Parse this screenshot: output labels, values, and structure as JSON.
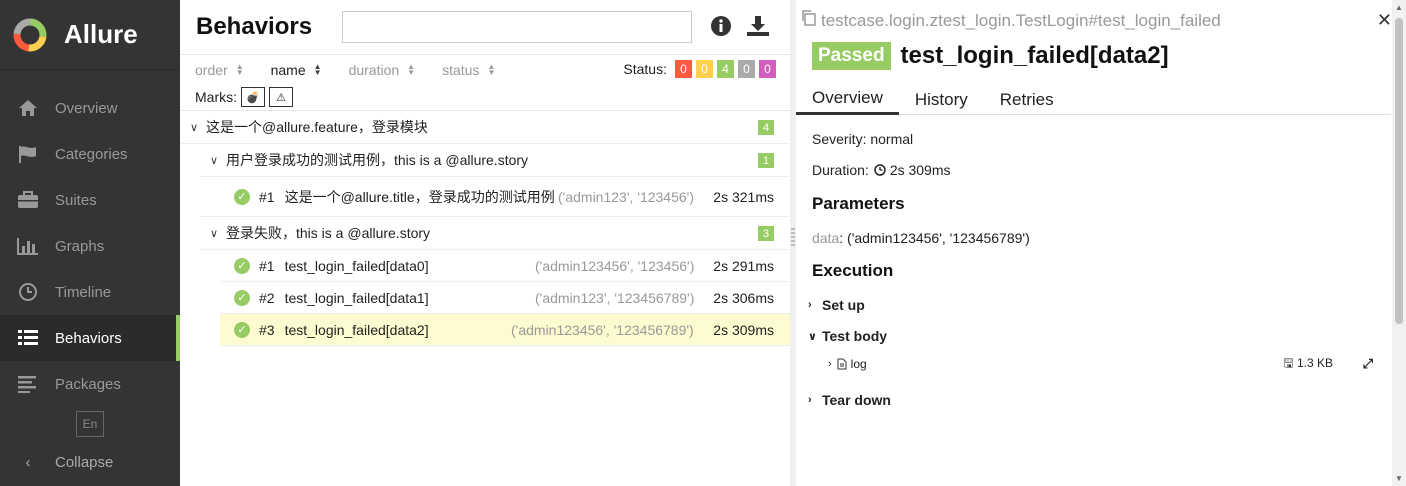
{
  "sidebar": {
    "brand": "Allure",
    "items": [
      {
        "label": "Overview",
        "icon": "home-icon"
      },
      {
        "label": "Categories",
        "icon": "flag-icon"
      },
      {
        "label": "Suites",
        "icon": "briefcase-icon"
      },
      {
        "label": "Graphs",
        "icon": "bar-chart-icon"
      },
      {
        "label": "Timeline",
        "icon": "clock-icon"
      },
      {
        "label": "Behaviors",
        "icon": "list-icon",
        "active": true
      },
      {
        "label": "Packages",
        "icon": "align-left-icon"
      }
    ],
    "language": "En",
    "collapse_label": "Collapse",
    "accent_color": "#97cc64"
  },
  "behaviors": {
    "title": "Behaviors",
    "search_placeholder": "",
    "sort": {
      "order": "order",
      "name": "name",
      "duration": "duration",
      "status": "status"
    },
    "status_label": "Status:",
    "status_counts": [
      {
        "value": "0",
        "color": "#fd5a3e"
      },
      {
        "value": "0",
        "color": "#ffd050"
      },
      {
        "value": "4",
        "color": "#97cc64"
      },
      {
        "value": "0",
        "color": "#aaaaaa"
      },
      {
        "value": "0",
        "color": "#d35ebe"
      }
    ],
    "marks_label": "Marks:",
    "tree": {
      "feature": {
        "label": "这是一个@allure.feature，登录模块",
        "count": "4"
      },
      "story1": {
        "label": "用户登录成功的测试用例，this is a @allure.story",
        "count": "1"
      },
      "story1_cases": [
        {
          "num": "#1",
          "name": "这是一个@allure.title，登录成功的测试用例",
          "params": "('admin123', '123456')",
          "duration": "2s 321ms"
        }
      ],
      "story2": {
        "label": "登录失败，this is a @allure.story",
        "count": "3"
      },
      "story2_cases": [
        {
          "num": "#1",
          "name": "test_login_failed[data0]",
          "params": "('admin123456', '123456')",
          "duration": "2s 291ms"
        },
        {
          "num": "#2",
          "name": "test_login_failed[data1]",
          "params": "('admin123', '123456789')",
          "duration": "2s 306ms"
        },
        {
          "num": "#3",
          "name": "test_login_failed[data2]",
          "params": "('admin123456', '123456789')",
          "duration": "2s 309ms"
        }
      ]
    }
  },
  "detail": {
    "breadcrumb": "testcase.login.ztest_login.TestLogin#test_login_failed",
    "status": "Passed",
    "title": "test_login_failed[data2]",
    "tabs": [
      "Overview",
      "History",
      "Retries"
    ],
    "severity": "Severity: normal",
    "duration_label": "Duration:",
    "duration_value": "2s 309ms",
    "parameters_heading": "Parameters",
    "param_key": "data",
    "param_value": ": ('admin123456', '123456789')",
    "execution_heading": "Execution",
    "steps": {
      "setup": "Set up",
      "body": "Test body",
      "teardown": "Tear down"
    },
    "attachment": {
      "name": "log",
      "size": "1.3 KB"
    }
  }
}
